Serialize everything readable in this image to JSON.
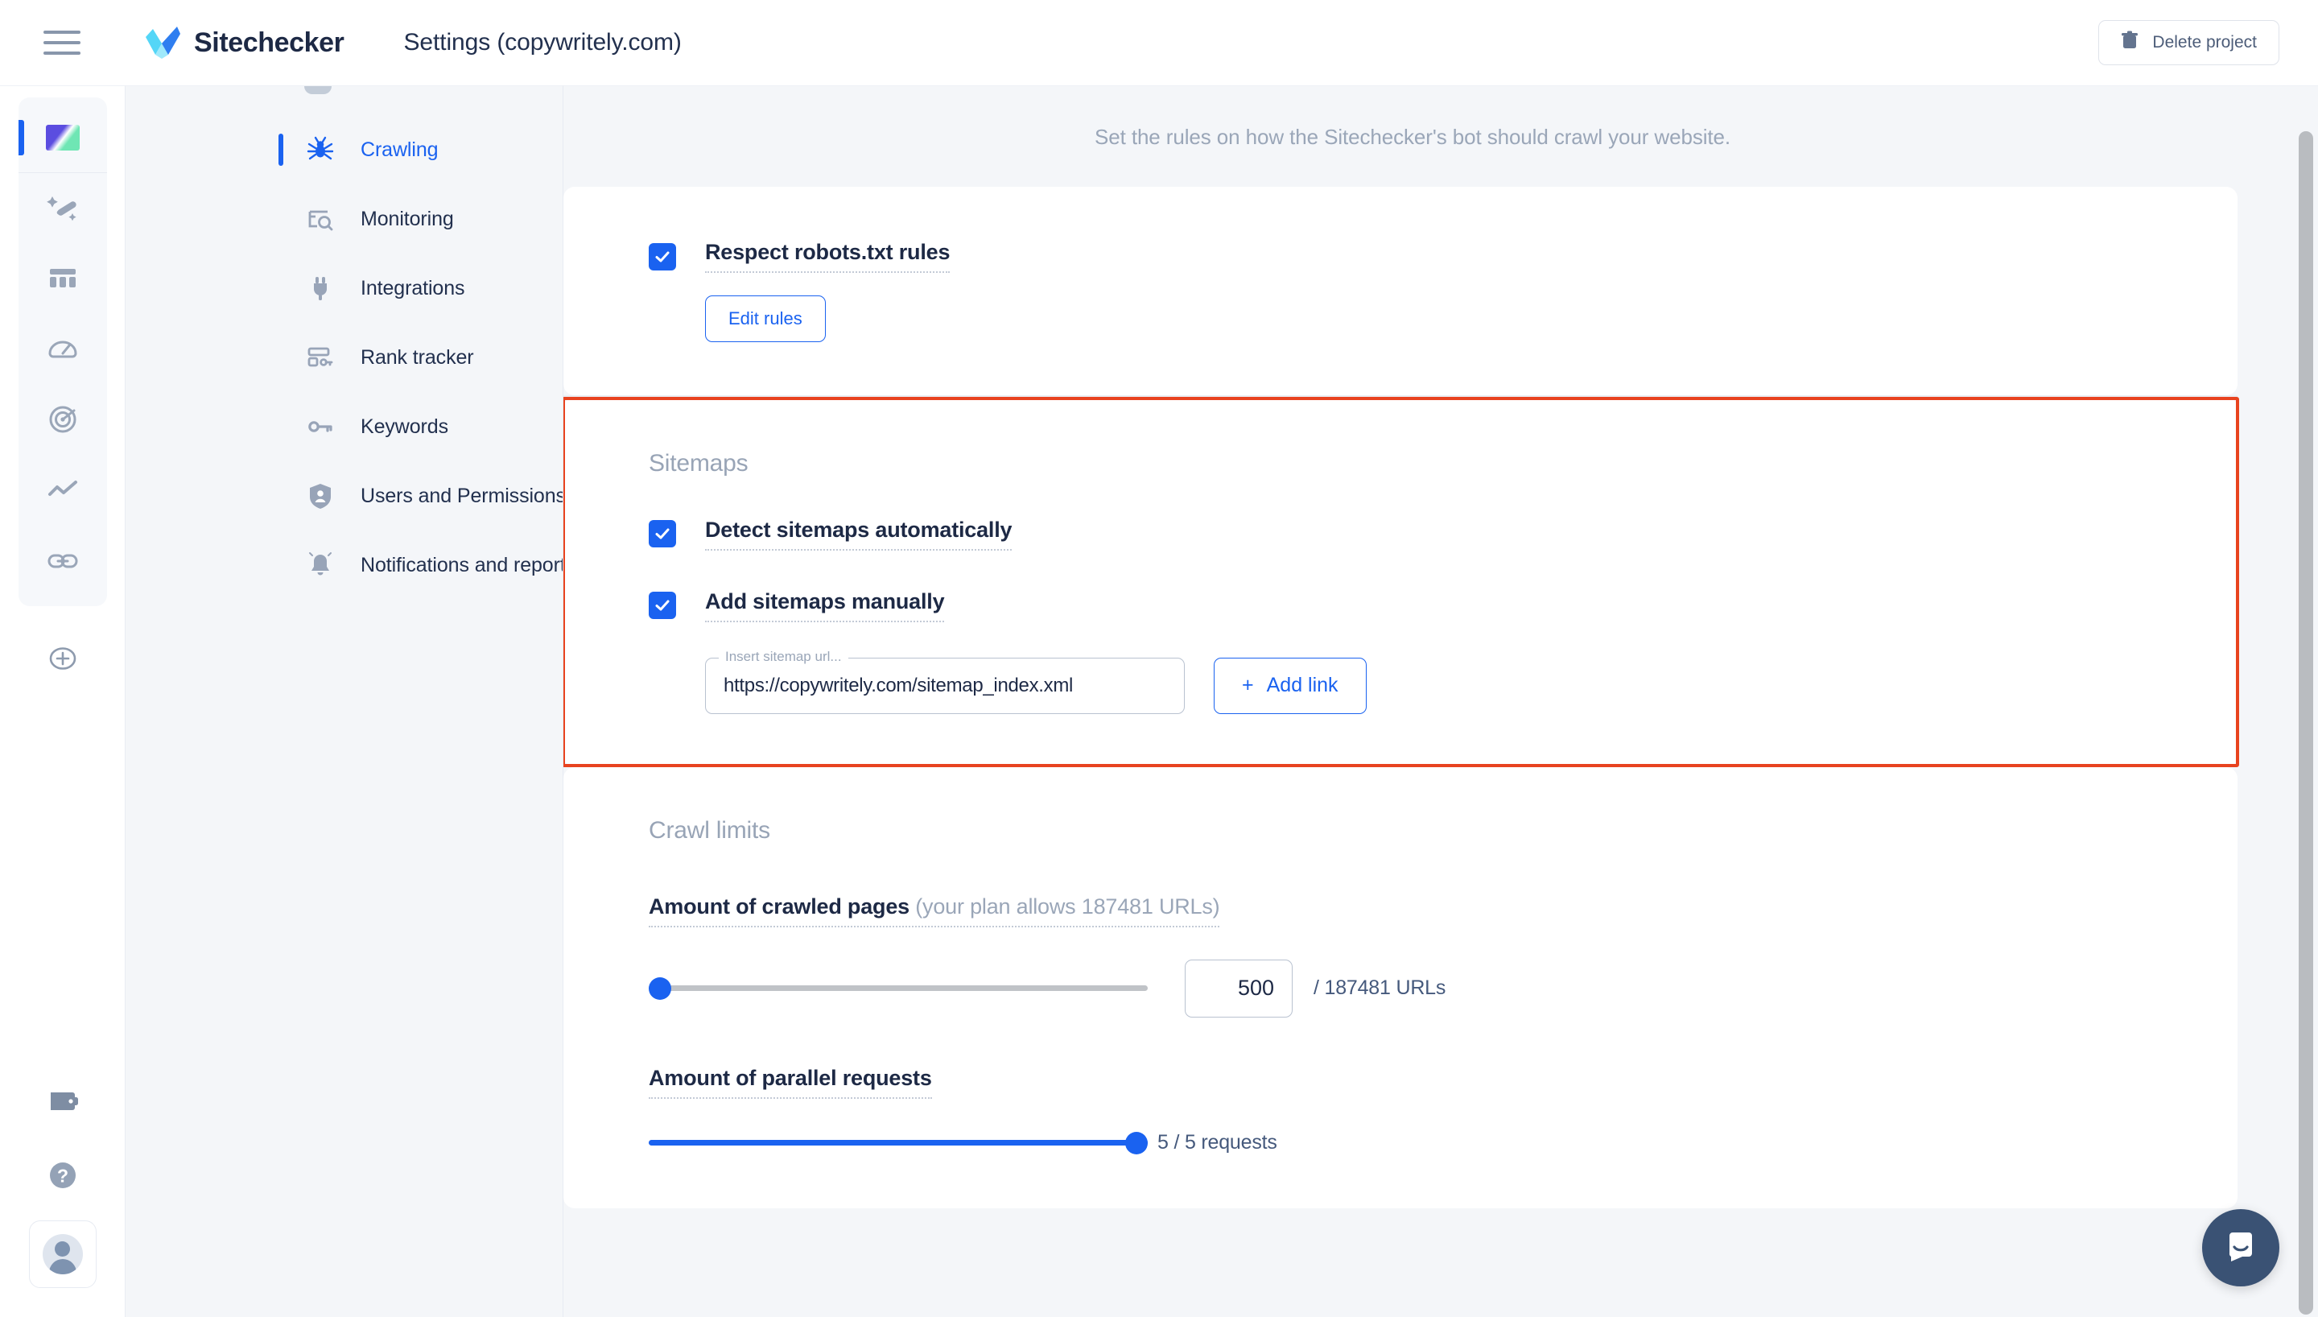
{
  "header": {
    "menu_icon": "hamburger-menu-icon",
    "brand": "Sitechecker",
    "page_title": "Settings (copywritely.com)",
    "delete_button": "Delete project",
    "delete_icon": "trash-icon"
  },
  "rail": {
    "items": [
      {
        "name": "project-thumbnail",
        "icon": "project-thumbnail-icon",
        "active": true
      },
      {
        "name": "site-audit",
        "icon": "magic-wand-icon",
        "active": false
      },
      {
        "name": "page-table",
        "icon": "table-columns-icon",
        "active": false
      },
      {
        "name": "speed-test",
        "icon": "gauge-icon",
        "active": false
      },
      {
        "name": "rank-radar",
        "icon": "radar-icon",
        "active": false
      },
      {
        "name": "trends",
        "icon": "trend-line-icon",
        "active": false
      },
      {
        "name": "backlinks",
        "icon": "link-icon",
        "active": false
      }
    ],
    "add_icon": "plus-circle-icon",
    "bottom": [
      {
        "name": "billing",
        "icon": "wallet-icon"
      },
      {
        "name": "help",
        "icon": "question-circle-icon"
      }
    ],
    "avatar_icon": "user-avatar-icon"
  },
  "nav": {
    "items": [
      {
        "label": "Crawling",
        "icon": "spider-icon",
        "active": true
      },
      {
        "label": "Monitoring",
        "icon": "monitor-search-icon",
        "active": false
      },
      {
        "label": "Integrations",
        "icon": "plug-icon",
        "active": false
      },
      {
        "label": "Rank tracker",
        "icon": "rank-table-icon",
        "active": false
      },
      {
        "label": "Keywords",
        "icon": "key-icon",
        "active": false
      },
      {
        "label": "Users and Permissions",
        "icon": "shield-user-icon",
        "active": false
      },
      {
        "label": "Notifications and reports",
        "icon": "bell-icon",
        "active": false
      }
    ]
  },
  "main": {
    "description": "Set the rules on how the Sitechecker's bot should crawl your website.",
    "robots": {
      "checkbox_label": "Respect robots.txt rules",
      "checked": true,
      "edit_button": "Edit rules"
    },
    "sitemaps": {
      "title": "Sitemaps",
      "highlighted": true,
      "highlight_color": "#e8431f",
      "detect_label": "Detect sitemaps automatically",
      "detect_checked": true,
      "manual_label": "Add sitemaps manually",
      "manual_checked": true,
      "url_legend": "Insert sitemap url...",
      "url_value": "https://copywritely.com/sitemap_index.xml",
      "add_link_button": "Add link",
      "add_link_icon": "plus-icon"
    },
    "crawl_limits": {
      "title": "Crawl limits",
      "pages_label": "Amount of crawled pages",
      "pages_hint": "(your plan allows 187481 URLs)",
      "pages_value": "500",
      "pages_suffix": "/ 187481 URLs",
      "pages_slider_percent": 0,
      "parallel_label": "Amount of parallel requests",
      "parallel_suffix": "5 / 5 requests",
      "parallel_slider_percent": 100
    }
  },
  "widgets": {
    "intercom_icon": "chat-bubble-icon",
    "scrollbar": "vertical-scrollbar"
  },
  "colors": {
    "accent": "#1a62f0",
    "highlight": "#e8431f",
    "text": "#1d2945",
    "muted": "#9aa6b8"
  }
}
